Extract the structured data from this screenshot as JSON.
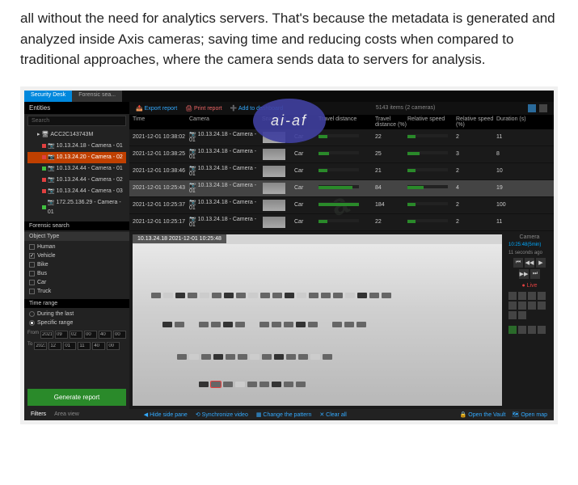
{
  "article": {
    "text": "all without the need for analytics servers. That's because the metadata is generated and analyzed inside Axis cameras; saving time and reducing costs when compared to traditional approaches, where the camera sends data to servers for analysis."
  },
  "watermark_logo": "ai-af",
  "tabs": {
    "active": "Security Desk",
    "inactive": "Forensic sea..."
  },
  "sidebar": {
    "title": "Entities",
    "search_placeholder": "Search",
    "root": "ACC2C143743M",
    "cameras": [
      {
        "label": "10.13.24.18 - Camera - 01",
        "sel": false,
        "status": "red"
      },
      {
        "label": "10.13.24.20 - Camera - 02",
        "sel": true,
        "status": "red"
      },
      {
        "label": "10.13.24.44 - Camera - 01",
        "sel": false,
        "status": "green"
      },
      {
        "label": "10.13.24.44 - Camera - 02",
        "sel": false,
        "status": "red"
      },
      {
        "label": "10.13.24.44 - Camera - 03",
        "sel": false,
        "status": "red"
      },
      {
        "label": "172.25.136.29 - Camera - 01",
        "sel": false,
        "status": "green"
      }
    ],
    "forensic_title": "Forensic search",
    "object_type_title": "Object Type",
    "object_types": [
      {
        "label": "Human",
        "checked": false
      },
      {
        "label": "Vehicle",
        "checked": true
      },
      {
        "label": "Bike",
        "checked": false
      },
      {
        "label": "Bus",
        "checked": false
      },
      {
        "label": "Car",
        "checked": false
      },
      {
        "label": "Truck",
        "checked": false
      }
    ],
    "time_range_title": "Time range",
    "during_last": "During the last",
    "specific_range": "Specific range",
    "from_label": "From",
    "to_label": "To",
    "date_from": [
      "2021",
      "09",
      "02",
      "00",
      "40",
      "00"
    ],
    "date_to": [
      "2021",
      "12",
      "01",
      "11",
      "40",
      "00"
    ],
    "generate": "Generate report"
  },
  "toolbar": {
    "export": "Export report",
    "print": "Print report",
    "add": "Add to dashboard",
    "center": "5143 items (2 cameras)"
  },
  "table": {
    "headers": {
      "time": "Time",
      "camera": "Camera",
      "snapshot": "Snapshot",
      "type": "Type",
      "dist": "Travel distance",
      "distn": "Travel distance (%)",
      "rel": "Relative speed",
      "reln": "Relative speed (%)",
      "dur": "Duration (s)"
    },
    "rows": [
      {
        "time": "2021-12-01 10:38:02",
        "camera": "10.13.24.18 - Camera - 01",
        "type": "Car",
        "dist": 22,
        "rel": 2,
        "dur": 11
      },
      {
        "time": "2021-12-01 10:38:25",
        "camera": "10.13.24.18 - Camera - 01",
        "type": "Car",
        "dist": 25,
        "rel": 3,
        "dur": 8
      },
      {
        "time": "2021-12-01 10:38:46",
        "camera": "10.13.24.18 - Camera - 01",
        "type": "Car",
        "dist": 21,
        "rel": 2,
        "dur": 10
      },
      {
        "time": "2021-12-01 10:25:43",
        "camera": "10.13.24.18 - Camera - 01",
        "type": "Car",
        "dist": 84,
        "rel": 4,
        "dur": 19,
        "selected": true
      },
      {
        "time": "2021-12-01 10:25:37",
        "camera": "10.13.24.18 - Camera - 01",
        "type": "Car",
        "dist": 184,
        "rel": 2,
        "dur": 100
      },
      {
        "time": "2021-12-01 10:25:17",
        "camera": "10.13.24.18 - Camera - 01",
        "type": "Car",
        "dist": 22,
        "rel": 2,
        "dur": 11
      }
    ]
  },
  "video": {
    "title": "10.13.24.18     2021-12-01 10:25:48"
  },
  "control_panel": {
    "title": "Camera",
    "info1": "10:25:48(5min)",
    "info2": "11 seconds ago",
    "live": "Live"
  },
  "bottom": {
    "filters": "Filters",
    "area": "Area view",
    "hide": "Hide side pane",
    "sync": "Synchronize video",
    "change": "Change the pattern",
    "clear": "Clear all",
    "vault": "Open the Vault",
    "map": "Open map"
  }
}
